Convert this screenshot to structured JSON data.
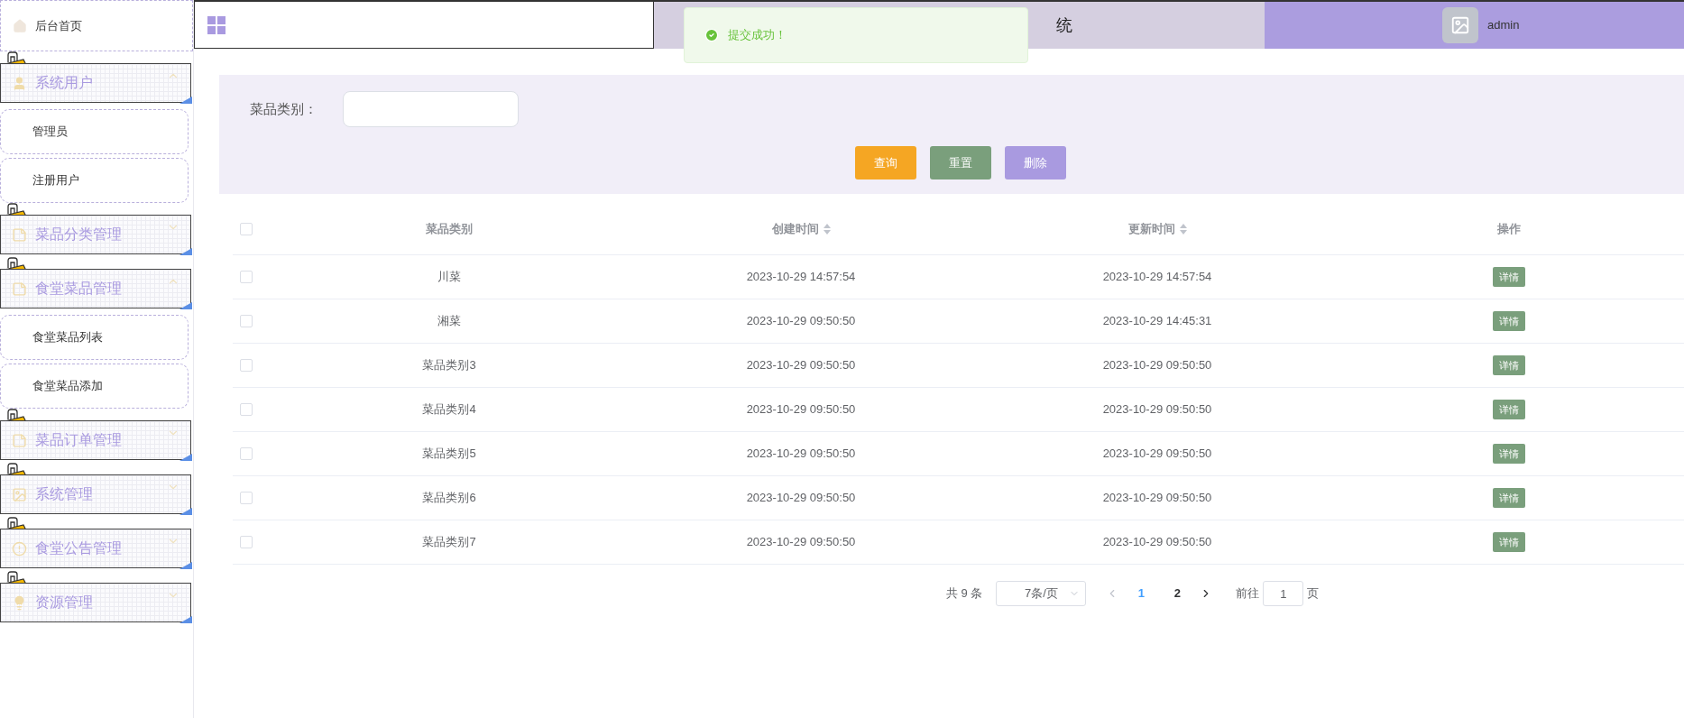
{
  "sidebar": {
    "items": [
      {
        "kind": "link",
        "label": "后台首页"
      },
      {
        "kind": "group",
        "label": "系统用户",
        "expanded": true,
        "children": [
          {
            "label": "管理员"
          },
          {
            "label": "注册用户"
          }
        ]
      },
      {
        "kind": "group",
        "label": "菜品分类管理",
        "expanded": false
      },
      {
        "kind": "group",
        "label": "食堂菜品管理",
        "expanded": true,
        "children": [
          {
            "label": "食堂菜品列表"
          },
          {
            "label": "食堂菜品添加"
          }
        ]
      },
      {
        "kind": "group",
        "label": "菜品订单管理",
        "expanded": false
      },
      {
        "kind": "group",
        "label": "系统管理",
        "expanded": false
      },
      {
        "kind": "group",
        "label": "食堂公告管理",
        "expanded": false
      },
      {
        "kind": "group",
        "label": "资源管理",
        "expanded": false
      }
    ]
  },
  "header": {
    "title": "统",
    "user": "admin"
  },
  "toast": {
    "message": "提交成功！"
  },
  "search": {
    "label": "菜品类别：",
    "buttons": [
      {
        "label": "查询",
        "color": "#f5a623"
      },
      {
        "label": "重置",
        "color": "#7a9f7c"
      },
      {
        "label": "删除",
        "color": "#a99ae0"
      }
    ]
  },
  "table": {
    "columns": [
      {
        "label": "菜品类别",
        "sortable": false
      },
      {
        "label": "创建时间",
        "sortable": true
      },
      {
        "label": "更新时间",
        "sortable": true
      },
      {
        "label": "操作",
        "sortable": false
      }
    ],
    "all_checked": false,
    "rows": [
      {
        "checked": false,
        "cells": [
          "川菜",
          "2023-10-29 14:57:54",
          "2023-10-29 14:57:54"
        ],
        "action": "详情"
      },
      {
        "checked": false,
        "cells": [
          "湘菜",
          "2023-10-29 09:50:50",
          "2023-10-29 14:45:31"
        ],
        "action": "详情"
      },
      {
        "checked": false,
        "cells": [
          "菜品类别3",
          "2023-10-29 09:50:50",
          "2023-10-29 09:50:50"
        ],
        "action": "详情"
      },
      {
        "checked": false,
        "cells": [
          "菜品类别4",
          "2023-10-29 09:50:50",
          "2023-10-29 09:50:50"
        ],
        "action": "详情"
      },
      {
        "checked": false,
        "cells": [
          "菜品类别5",
          "2023-10-29 09:50:50",
          "2023-10-29 09:50:50"
        ],
        "action": "详情"
      },
      {
        "checked": false,
        "cells": [
          "菜品类别6",
          "2023-10-29 09:50:50",
          "2023-10-29 09:50:50"
        ],
        "action": "详情"
      },
      {
        "checked": false,
        "cells": [
          "菜品类别7",
          "2023-10-29 09:50:50",
          "2023-10-29 09:50:50"
        ],
        "action": "详情"
      }
    ]
  },
  "pagination": {
    "total": "共 9 条",
    "page_size": "7条/页",
    "pages": [
      {
        "label": "1",
        "selected": true
      },
      {
        "label": "2",
        "selected": false
      }
    ],
    "goto_label": "前往",
    "goto_value": "1",
    "goto_suffix": "页"
  }
}
